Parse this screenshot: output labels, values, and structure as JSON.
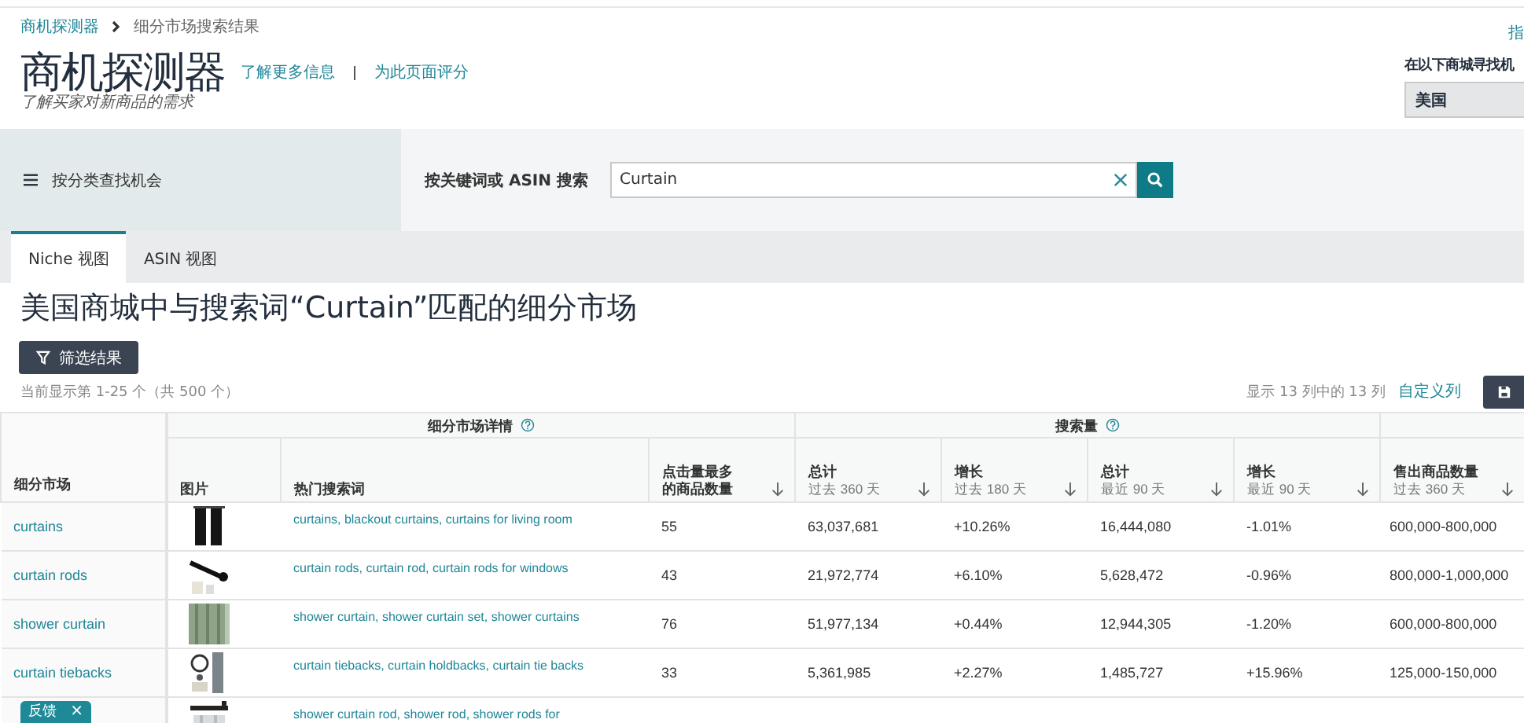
{
  "breadcrumb": [
    {
      "label": "商机探测器",
      "link": true
    },
    {
      "label": "细分市场搜索结果",
      "link": false
    }
  ],
  "header": {
    "title": "商机探测器",
    "subtitle": "了解买家对新商品的需求",
    "links": [
      "了解更多信息",
      "为此页面评分"
    ],
    "corner_link": "指"
  },
  "marketplace": {
    "label": "在以下商城寻找机",
    "value": "美国"
  },
  "category_button": "按分类查找机会",
  "search": {
    "label": "按关键词或 ASIN 搜索",
    "value": "Curtain"
  },
  "tabs": [
    {
      "label": "Niche 视图",
      "selected": true
    },
    {
      "label": "ASIN 视图",
      "selected": false
    }
  ],
  "heading": "美国商城中与搜索词“Curtain”匹配的细分市场",
  "filter_button": "筛选结果",
  "result_count": "当前显示第 1-25 个（共 500 个）",
  "columns_info": "显示 13 列中的 13 列",
  "customize_link": "自定义列",
  "table": {
    "groups": [
      {
        "label": "细分市场详情",
        "help": true
      },
      {
        "label": "搜索量",
        "help": true
      }
    ],
    "columns": [
      {
        "label": "细分市场",
        "kind": "link",
        "sortable": false
      },
      {
        "label": "图片",
        "kind": "picture",
        "sortable": false
      },
      {
        "label": "热门搜索词",
        "kind": "link",
        "sortable": false
      },
      {
        "label": "点击量最多的商品数量",
        "kind": "text",
        "sortable": true
      },
      {
        "label": "总计",
        "sublabel": "过去 360 天",
        "kind": "text",
        "sortable": true
      },
      {
        "label": "增长",
        "sublabel": "过去 180 天",
        "kind": "text",
        "sortable": true
      },
      {
        "label": "总计",
        "sublabel": "最近 90 天",
        "kind": "text",
        "sortable": true
      },
      {
        "label": "增长",
        "sublabel": "最近 90 天",
        "kind": "text",
        "sortable": true
      },
      {
        "label": "售出商品数量",
        "sublabel": "过去 360 天",
        "kind": "text",
        "sortable": true
      }
    ],
    "rows": [
      {
        "cells": [
          "curtains",
          "",
          "curtains, blackout curtains, curtains for living room",
          "55",
          "63,037,681",
          "+10.26%",
          "16,444,080",
          "-1.01%",
          "600,000-800,000"
        ]
      },
      {
        "cells": [
          "curtain rods",
          "",
          "curtain rods, curtain rod, curtain rods for windows",
          "43",
          "21,972,774",
          "+6.10%",
          "5,628,472",
          "-0.96%",
          "800,000-1,000,000"
        ]
      },
      {
        "cells": [
          "shower curtain",
          "",
          "shower curtain, shower curtain set, shower curtains",
          "76",
          "51,977,134",
          "+0.44%",
          "12,944,305",
          "-1.20%",
          "600,000-800,000"
        ]
      },
      {
        "cells": [
          "curtain tiebacks",
          "",
          "curtain tiebacks, curtain holdbacks, curtain tie backs",
          "33",
          "5,361,985",
          "+2.27%",
          "1,485,727",
          "+15.96%",
          "125,000-150,000"
        ]
      },
      {
        "cells": [
          "",
          "",
          "shower curtain rod, shower rod, shower rods for"
        ]
      }
    ]
  },
  "feedback": {
    "label": "反馈",
    "close": "×"
  }
}
